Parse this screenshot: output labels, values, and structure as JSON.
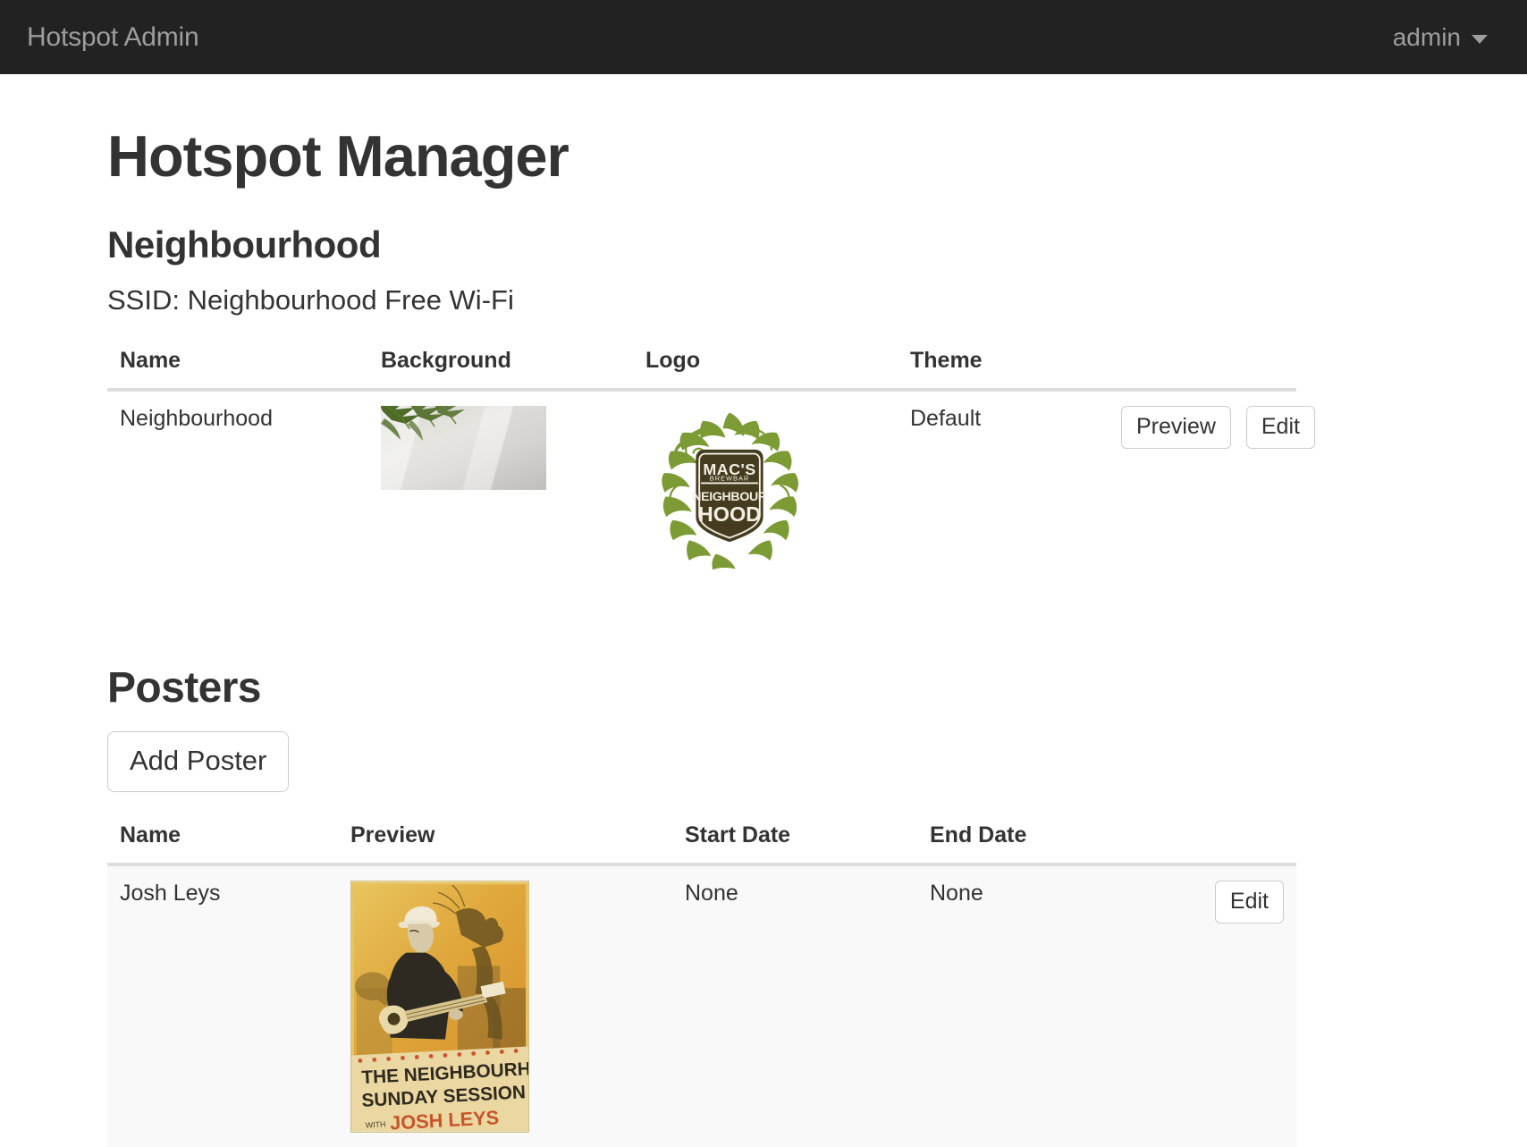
{
  "navbar": {
    "brand": "Hotspot Admin",
    "user": "admin",
    "caret_icon": "chevron-down-icon"
  },
  "page": {
    "title": "Hotspot Manager"
  },
  "hotspot": {
    "name_heading": "Neighbourhood",
    "ssid_line": "SSID: Neighbourhood Free Wi-Fi",
    "table": {
      "columns": [
        "Name",
        "Background",
        "Logo",
        "Theme",
        ""
      ],
      "rows": [
        {
          "name": "Neighbourhood",
          "background_alt": "background-image-thumbnail",
          "logo_alt": "macs-brewbar-neighbourhood-logo",
          "theme": "Default",
          "preview_label": "Preview",
          "edit_label": "Edit"
        }
      ]
    }
  },
  "posters": {
    "heading": "Posters",
    "add_label": "Add Poster",
    "table": {
      "columns": [
        "Name",
        "Preview",
        "Start Date",
        "End Date",
        ""
      ],
      "rows": [
        {
          "name": "Josh Leys",
          "preview_alt": "josh-leys-poster-thumbnail",
          "start_date": "None",
          "end_date": "None",
          "edit_label": "Edit"
        }
      ]
    }
  },
  "colors": {
    "navbar_bg": "#222222",
    "navbar_text": "#9d9d9d",
    "body_text": "#333333",
    "border": "#dddddd",
    "button_border": "#cccccc",
    "row_stripe": "#f9f9f9",
    "logo_green": "#7d9b34",
    "logo_brown": "#453c20",
    "poster_amber": "#e3b64a"
  }
}
